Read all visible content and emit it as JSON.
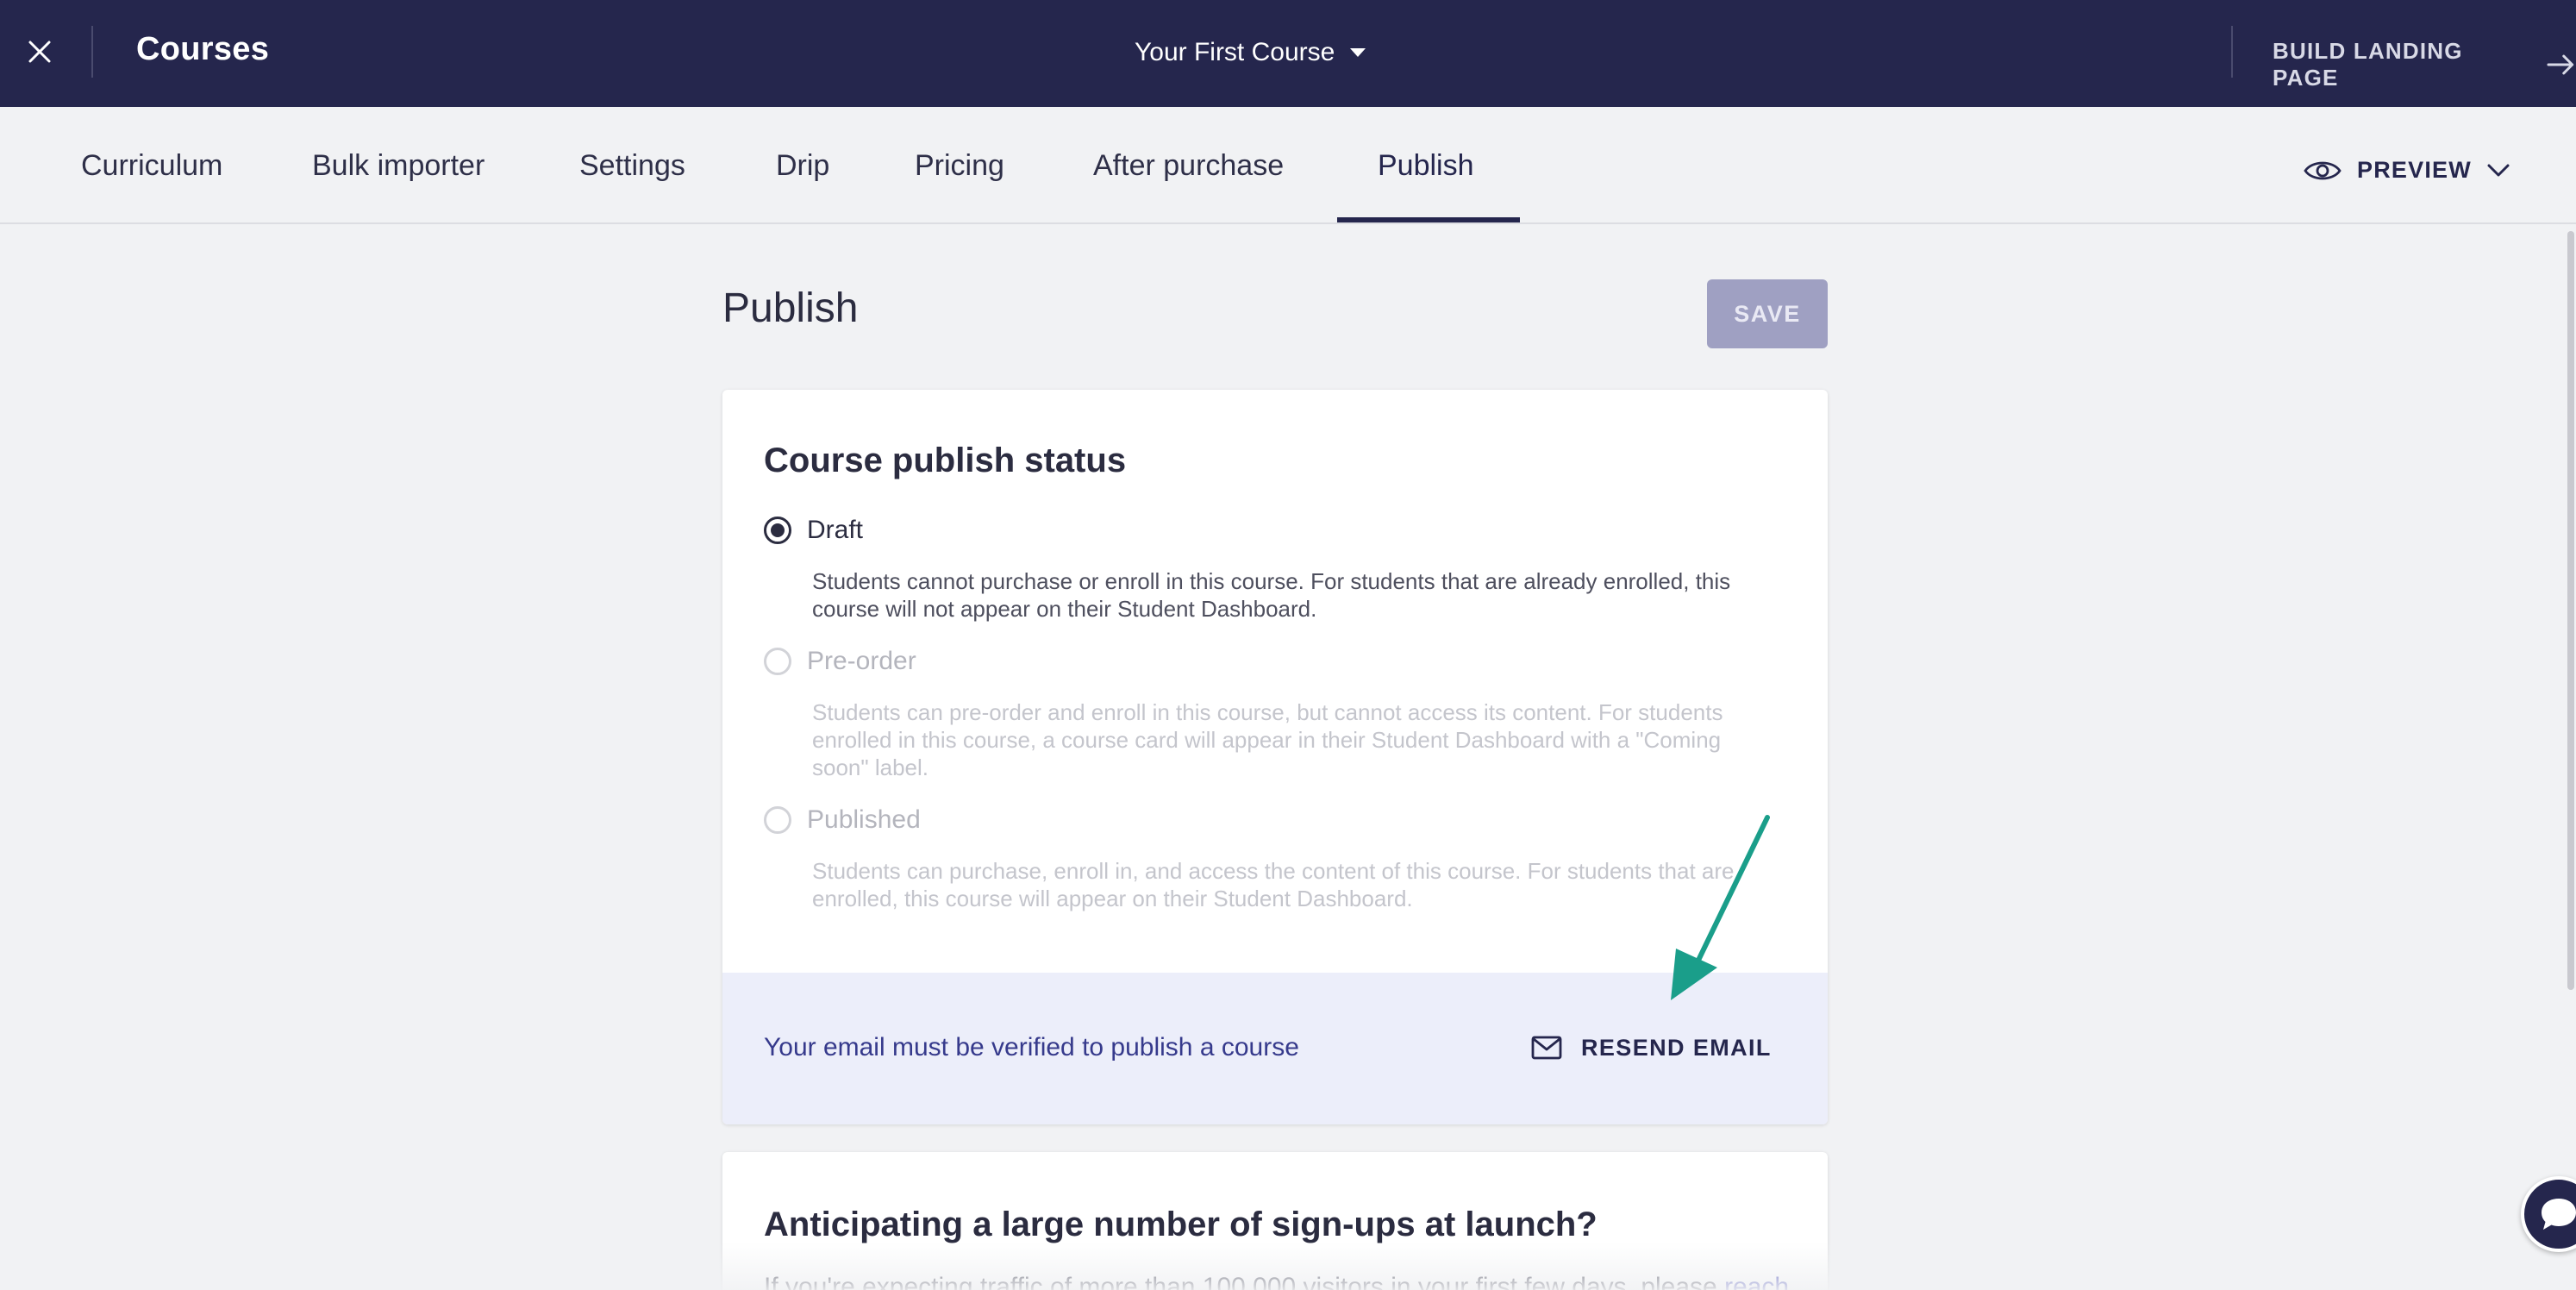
{
  "topbar": {
    "title": "Courses",
    "course_selector": "Your First Course",
    "build_landing_label": "BUILD LANDING PAGE"
  },
  "tabs": [
    {
      "label": "Curriculum",
      "active": false
    },
    {
      "label": "Bulk importer",
      "active": false
    },
    {
      "label": "Settings",
      "active": false
    },
    {
      "label": "Drip",
      "active": false
    },
    {
      "label": "Pricing",
      "active": false
    },
    {
      "label": "After purchase",
      "active": false
    },
    {
      "label": "Publish",
      "active": true
    }
  ],
  "preview_label": "PREVIEW",
  "page": {
    "title": "Publish",
    "save_label": "SAVE"
  },
  "publish_card": {
    "title": "Course publish status",
    "options": [
      {
        "label": "Draft",
        "selected": true,
        "disabled": false,
        "description": "Students cannot purchase or enroll in this course. For students that are already enrolled, this course will not appear on their Student Dashboard."
      },
      {
        "label": "Pre-order",
        "selected": false,
        "disabled": true,
        "description": "Students can pre-order and enroll in this course, but cannot access its content. For students enrolled in this course, a course card will appear in their Student Dashboard with a \"Coming soon\" label."
      },
      {
        "label": "Published",
        "selected": false,
        "disabled": true,
        "description": "Students can purchase, enroll in, and access the content of this course. For students that are enrolled, this course will appear on their Student Dashboard."
      }
    ],
    "verify_message": "Your email must be verified to publish a course",
    "resend_label": "RESEND EMAIL"
  },
  "signup_card": {
    "title": "Anticipating a large number of sign-ups at launch?",
    "body": "If you're expecting traffic of more than 100,000 visitors in your first few days, please ",
    "link": "reach"
  },
  "colors": {
    "topbar_bg": "#25264d",
    "accent": "#25264d",
    "save_disabled": "#9fa0c2",
    "verify_bg": "#eceefa",
    "annotation_arrow": "#1a9e8a"
  },
  "icons": {
    "close": "close-icon",
    "caret": "caret-down-icon",
    "build_arrow": "arrow-right-icon",
    "preview": "eye-icon",
    "preview_chevron": "chevron-down-icon",
    "resend": "envelope-icon",
    "chat": "chat-bubble-icon"
  }
}
